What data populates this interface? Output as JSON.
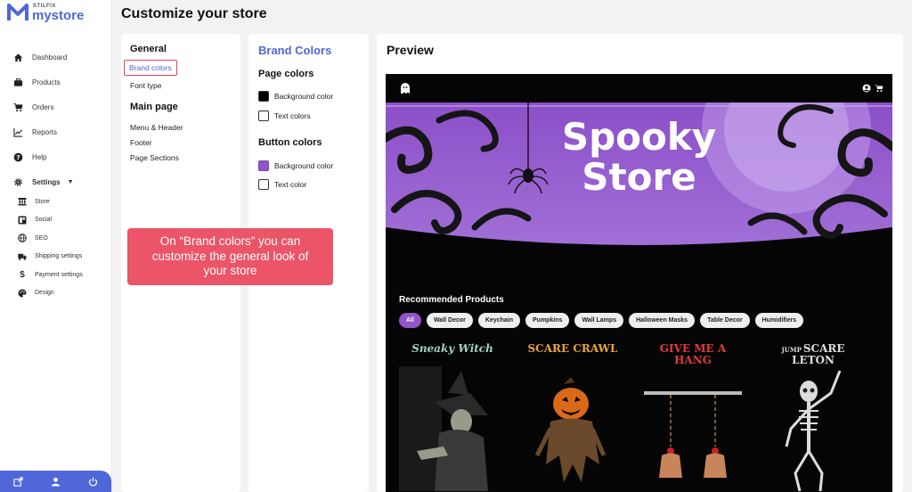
{
  "brand": {
    "small": "STILFIX",
    "name": "mystore",
    "accent": "#4f67d9"
  },
  "sidebar": {
    "items": [
      {
        "label": "Dashboard",
        "icon": "home-icon"
      },
      {
        "label": "Products",
        "icon": "briefcase-icon"
      },
      {
        "label": "Orders",
        "icon": "cart-icon"
      },
      {
        "label": "Reports",
        "icon": "chart-icon"
      },
      {
        "label": "Help",
        "icon": "help-icon"
      },
      {
        "label": "Settings",
        "icon": "gear-icon"
      }
    ],
    "settings_sub": [
      {
        "label": "Store",
        "icon": "store-icon"
      },
      {
        "label": "Social",
        "icon": "social-icon"
      },
      {
        "label": "SEO",
        "icon": "globe-icon"
      },
      {
        "label": "Shipping settings",
        "icon": "truck-icon"
      },
      {
        "label": "Payment settings",
        "icon": "dollar-icon"
      },
      {
        "label": "Design",
        "icon": "palette-icon"
      }
    ]
  },
  "header": {
    "title": "Customize your store"
  },
  "settings_nav": {
    "general_title": "General",
    "general_items": [
      "Brand colors",
      "Font type"
    ],
    "main_title": "Main page",
    "main_items": [
      "Menu & Header",
      "Footer",
      "Page Sections"
    ]
  },
  "brand_colors": {
    "title": "Brand Colors",
    "page_colors_title": "Page colors",
    "page_bg_label": "Background color",
    "page_bg_color": "#000000",
    "page_text_label": "Text colors",
    "page_text_color": "#ffffff",
    "button_colors_title": "Button colors",
    "button_bg_label": "Background color",
    "button_bg_color": "#9155c9",
    "button_text_label": "Text color",
    "button_text_color": "#ffffff"
  },
  "preview": {
    "title": "Preview",
    "banner_line1": "Spooky",
    "banner_line2": "Store",
    "recommended_title": "Recommended Products",
    "chips": [
      "All",
      "Wall Decor",
      "Keychain",
      "Pumpkins",
      "Wall Lamps",
      "Halloween Masks",
      "Table Decor",
      "Humidifiers"
    ],
    "products": [
      "Sneaky Witch",
      "SCARE CRAWL",
      "GIVE ME A HANG",
      "SCARE LETON"
    ],
    "product_prefix": "JUMP"
  },
  "callout": {
    "text": "On “Brand colors” you can customize the general look of your store"
  }
}
